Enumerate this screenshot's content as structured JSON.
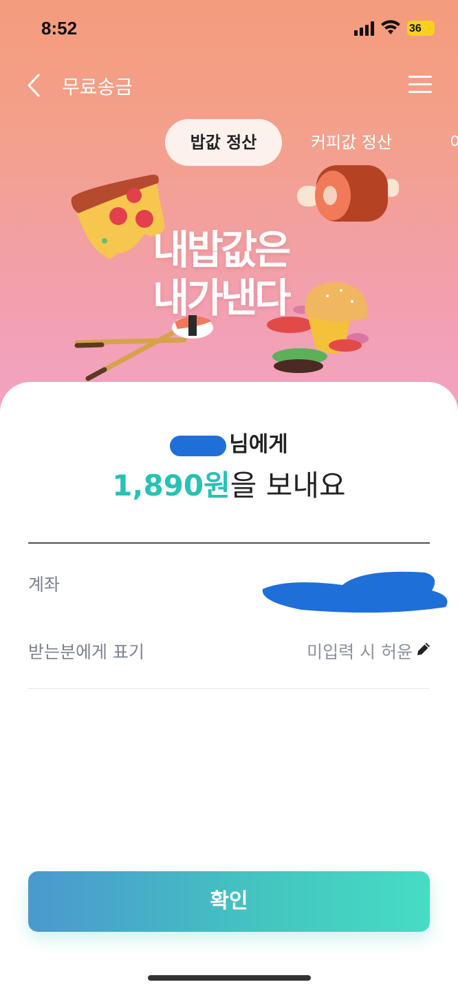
{
  "status_bar": {
    "time": "8:52",
    "battery": "36"
  },
  "nav": {
    "title": "무료송금"
  },
  "tabs": [
    {
      "label": "밥값 정산",
      "active": true
    },
    {
      "label": "커피값 정산",
      "active": false
    },
    {
      "label": "이",
      "active": false
    }
  ],
  "banner": {
    "headline_line1": "내밥값은",
    "headline_line2": "내가낸다"
  },
  "transfer": {
    "recipient_suffix": "님에게",
    "amount": "1,890원",
    "amount_suffix": "을 보내요"
  },
  "details": {
    "account_label": "계좌",
    "display_label": "받는분에게 표기",
    "display_value": "미입력 시 허윤"
  },
  "confirm_button": {
    "label": "확인"
  },
  "colors": {
    "accent_teal": "#28c1b4",
    "button_start": "#4b98cf",
    "button_end": "#47dcc4",
    "hero_top": "#f49c7c",
    "hero_bottom": "#f3a4c4"
  }
}
